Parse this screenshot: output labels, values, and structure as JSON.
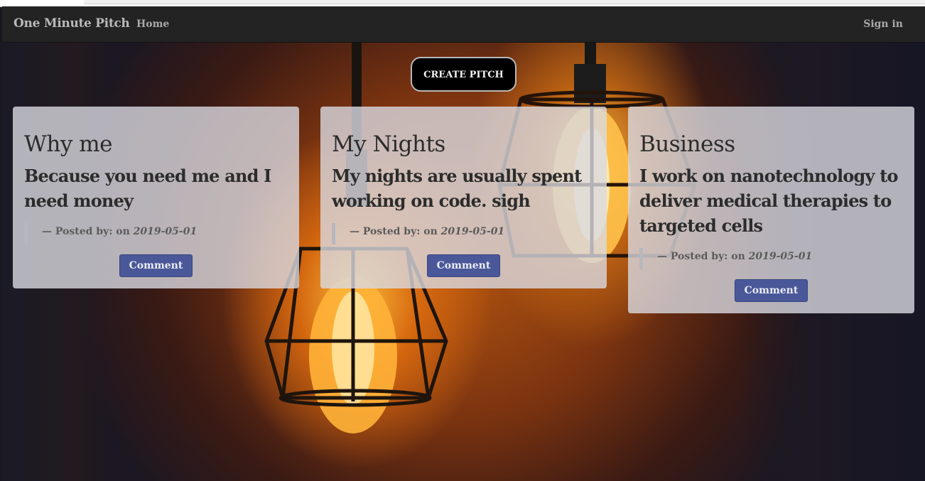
{
  "navbar": {
    "brand": "One Minute Pitch",
    "home": "Home",
    "sign_in": "Sign in"
  },
  "create_pitch": "CREATE PITCH",
  "pitches": [
    {
      "category": "Why me",
      "text": "Because you need me and I need money",
      "posted_by": "— Posted by: on ",
      "date": "2019-05-01",
      "comment_label": "Comment"
    },
    {
      "category": "My Nights",
      "text": "My nights are usually spent working on code. sigh",
      "posted_by": "— Posted by: on ",
      "date": "2019-05-01",
      "comment_label": "Comment"
    },
    {
      "category": "Business",
      "text": "I work on nanotechnology to deliver medical therapies to targeted cells",
      "posted_by": "— Posted by: on ",
      "date": "2019-05-01",
      "comment_label": "Comment"
    }
  ],
  "colors": {
    "navbar_bg": "#232323",
    "comment_button": "#4a5899",
    "create_button": "#000000",
    "card_bg": "#dadae1"
  }
}
